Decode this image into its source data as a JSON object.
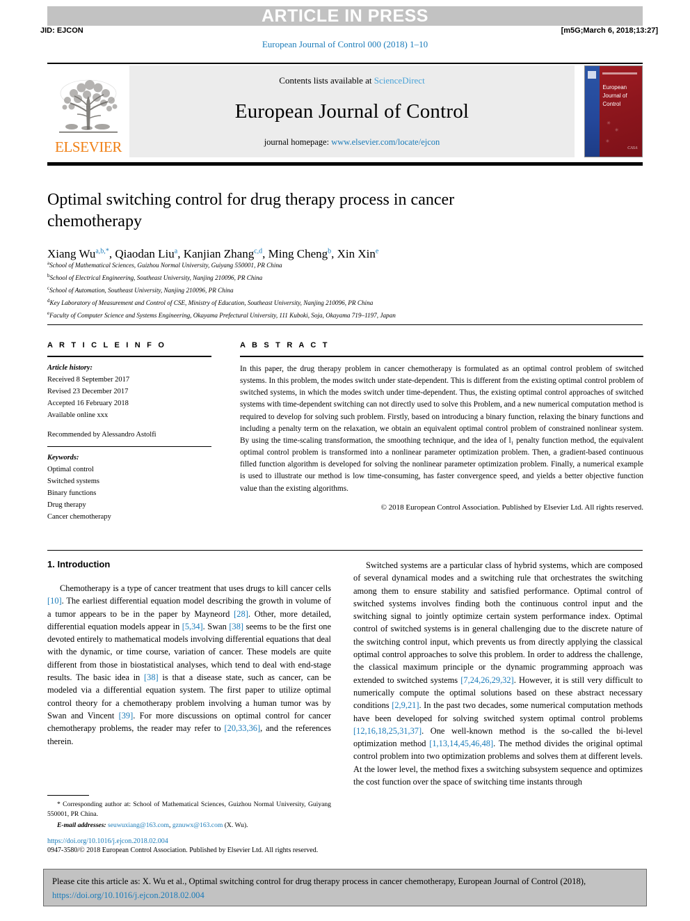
{
  "header": {
    "banner_text": "ARTICLE IN PRESS",
    "jid": "JID: EJCON",
    "build_stamp": "[m5G;March 6, 2018;13:27]",
    "journal_ref": "European Journal of Control 000 (2018) 1–10"
  },
  "masthead": {
    "publisher_logo_text": "ELSEVIER",
    "contents_prefix": "Contents lists available at ",
    "contents_link": "ScienceDirect",
    "journal_title": "European Journal of Control",
    "homepage_prefix": "journal homepage: ",
    "homepage_url": "www.elsevier.com/locate/ejcon",
    "cover_title": "European Journal of Control",
    "cover_mark": "CASA"
  },
  "article": {
    "title": "Optimal switching control for drug therapy process in cancer chemotherapy",
    "authors": [
      {
        "name": "Xiang Wu",
        "sup": "a,b,",
        "star": "*"
      },
      {
        "name": "Qiaodan Liu",
        "sup": "a",
        "star": ""
      },
      {
        "name": "Kanjian Zhang",
        "sup": "c,d",
        "star": ""
      },
      {
        "name": "Ming Cheng",
        "sup": "b",
        "star": ""
      },
      {
        "name": "Xin Xin",
        "sup": "e",
        "star": ""
      }
    ],
    "affiliations": [
      {
        "key": "a",
        "text": "School of Mathematical Sciences, Guizhou Normal University, Guiyang 550001, PR China"
      },
      {
        "key": "b",
        "text": "School of Electrical Engineering, Southeast University, Nanjing 210096, PR China"
      },
      {
        "key": "c",
        "text": "School of Automation, Southeast University, Nanjing 210096, PR China"
      },
      {
        "key": "d",
        "text": "Key Laboratory of Measurement and Control of CSE, Ministry of Education, Southeast University, Nanjing 210096, PR China"
      },
      {
        "key": "e",
        "text": "Faculty of Computer Science and Systems Engineering, Okayama Prefectural University, 111 Kuboki, Soja, Okayama 719–1197, Japan"
      }
    ]
  },
  "article_info": {
    "heading": "A R T I C L E   I N F O",
    "history_label": "Article history:",
    "history": [
      "Received 8 September 2017",
      "Revised 23 December 2017",
      "Accepted 16 February 2018",
      "Available online xxx"
    ],
    "recommended_by": "Recommended by Alessandro Astolfi",
    "keywords_label": "Keywords:",
    "keywords": [
      "Optimal control",
      "Switched systems",
      "Binary functions",
      "Drug therapy",
      "Cancer chemotherapy"
    ]
  },
  "abstract": {
    "heading": "A B S T R A C T",
    "text": "In this paper, the drug therapy problem in cancer chemotherapy is formulated as an optimal control problem of switched systems. In this problem, the modes switch under state-dependent. This is different from the existing optimal control problem of switched systems, in which the modes switch under time-dependent. Thus, the existing optimal control approaches of switched systems with time-dependent switching can not directly used to solve this Problem, and a new numerical computation method is required to develop for solving such problem. Firstly, based on introducing a binary function, relaxing the binary functions and including a penalty term on the relaxation, we obtain an equivalent optimal control problem of constrained nonlinear system. By using the time-scaling transformation, the smoothing technique, and the idea of l₁ penalty function method, the equivalent optimal control problem is transformed into a nonlinear parameter optimization problem. Then, a gradient-based continuous filled function algorithm is developed for solving the nonlinear parameter optimization problem. Finally, a numerical example is used to illustrate our method is low time-consuming, has faster convergence speed, and yields a better objective function value than the existing algorithms.",
    "copyright": "© 2018 European Control Association. Published by Elsevier Ltd. All rights reserved."
  },
  "body": {
    "section_title": "1. Introduction",
    "left_paragraph_parts": [
      {
        "t": "Chemotherapy is a type of cancer treatment that uses drugs to kill cancer cells ",
        "r": false
      },
      {
        "t": "[10]",
        "r": true
      },
      {
        "t": ". The earliest differential equation model describing the growth in volume of a tumor appears to be in the paper by Mayneord ",
        "r": false
      },
      {
        "t": "[28]",
        "r": true
      },
      {
        "t": ". Other, more detailed, differential equation models appear in ",
        "r": false
      },
      {
        "t": "[5,34]",
        "r": true
      },
      {
        "t": ". Swan ",
        "r": false
      },
      {
        "t": "[38]",
        "r": true
      },
      {
        "t": " seems to be the first one devoted entirely to mathematical models involving differential equations that deal with the dynamic, or time course, variation of cancer. These models are quite different from those in biostatistical analyses, which tend to deal with end-stage results. The basic idea in ",
        "r": false
      },
      {
        "t": "[38]",
        "r": true
      },
      {
        "t": " is that a disease state, such as cancer, can be modeled via a differential equation system. The first paper to utilize optimal control theory for a chemotherapy problem involving a human tumor was by Swan and Vincent ",
        "r": false
      },
      {
        "t": "[39]",
        "r": true
      },
      {
        "t": ". For more discussions on optimal control for cancer chemotherapy problems, the reader may refer to ",
        "r": false
      },
      {
        "t": "[20,33,36]",
        "r": true
      },
      {
        "t": ", and the references therein.",
        "r": false
      }
    ],
    "right_paragraph_parts": [
      {
        "t": "Switched systems are a particular class of hybrid systems, which are composed of several dynamical modes and a switching rule that orchestrates the switching among them to ensure stability and satisfied performance. Optimal control of switched systems involves finding both the continuous control input and the switching signal to jointly optimize certain system performance index. Optimal control of switched systems is in general challenging due to the discrete nature of the switching control input, which prevents us from directly applying the classical optimal control approaches to solve this problem. In order to address the challenge, the classical maximum principle or the dynamic programming approach was extended to switched systems ",
        "r": false
      },
      {
        "t": "[7,24,26,29,32]",
        "r": true
      },
      {
        "t": ". However, it is still very difficult to numerically compute the optimal solutions based on these abstract necessary conditions ",
        "r": false
      },
      {
        "t": "[2,9,21]",
        "r": true
      },
      {
        "t": ". In the past two decades, some numerical computation methods have been developed for solving switched system optimal control problems ",
        "r": false
      },
      {
        "t": "[12,16,18,25,31,37]",
        "r": true
      },
      {
        "t": ". One well-known method is the so-called the bi-level optimization method ",
        "r": false
      },
      {
        "t": "[1,13,14,45,46,48]",
        "r": true
      },
      {
        "t": ". The method divides the original optimal control problem into two optimization problems and solves them at different levels. At the lower level, the method fixes a switching subsystem sequence and optimizes the cost function over the space of switching time instants through",
        "r": false
      }
    ]
  },
  "footnotes": {
    "corresponding": "Corresponding author at: School of Mathematical Sciences, Guizhou Normal University, Guiyang 550001, PR China.",
    "email_label": "E-mail addresses:",
    "email_1": "seuwuxiang@163.com",
    "email_2": "gznuwx@163.com",
    "email_suffix": "(X. Wu).",
    "doi": "https://doi.org/10.1016/j.ejcon.2018.02.004",
    "issn_line": "0947-3580/© 2018 European Control Association. Published by Elsevier Ltd. All rights reserved."
  },
  "cite_box": {
    "prefix": "Please cite this article as: X. Wu et al., Optimal switching control for drug therapy process in cancer chemotherapy, European Journal of Control (2018), ",
    "url": "https://doi.org/10.1016/j.ejcon.2018.02.004"
  },
  "colors": {
    "link": "#1a7bb9",
    "banner_bg": "#c2c2c2",
    "masthead_bg": "#ececec",
    "elsevier_orange": "#f07f13",
    "cover_red": "#9e1b21",
    "cover_blue": "#24479a"
  }
}
